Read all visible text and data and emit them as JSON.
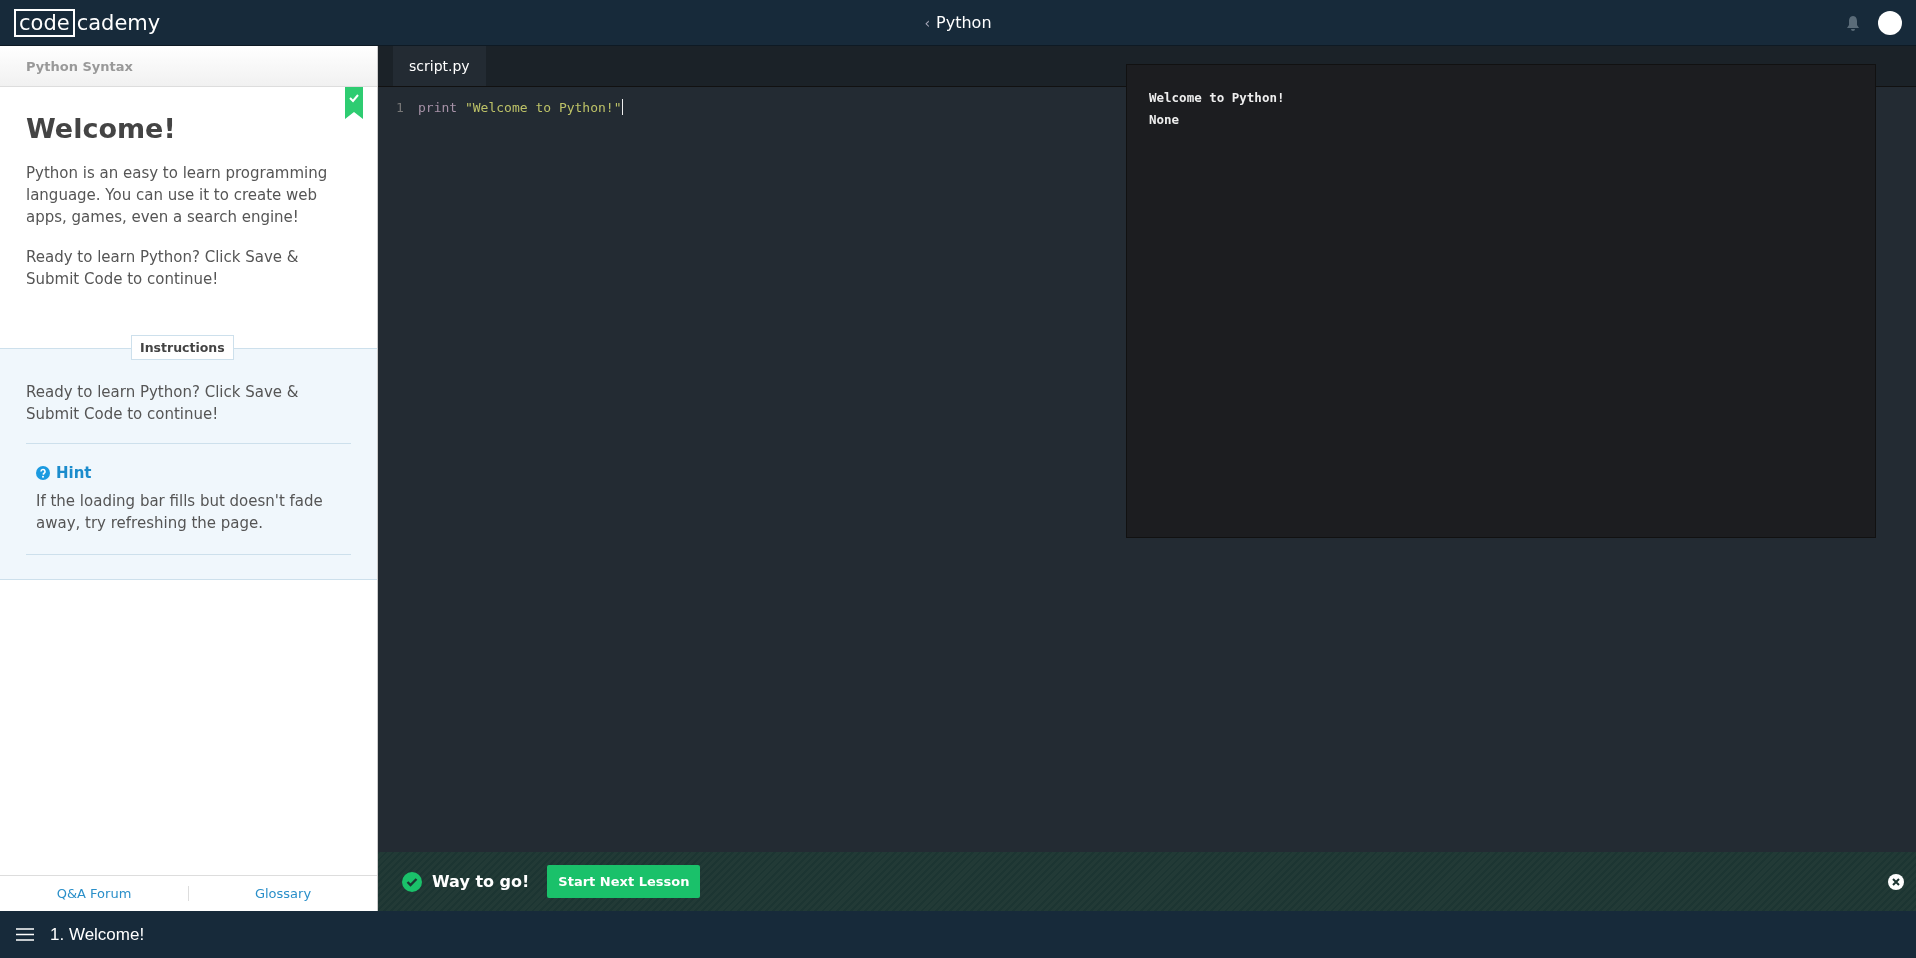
{
  "header": {
    "logo_boxed": "code",
    "logo_rest": "cademy",
    "course": "Python",
    "back_icon": "‹"
  },
  "sidebar": {
    "section": "Python Syntax",
    "completed": true,
    "title": "Welcome!",
    "paragraphs": [
      "Python is an easy to learn programming language. You can use it to create web apps, games, even a search engine!",
      "Ready to learn Python? Click Save & Submit Code to continue!"
    ],
    "instructions_label": "Instructions",
    "instructions": "Ready to learn Python? Click Save & Submit Code to continue!",
    "hint": {
      "label": "Hint",
      "text": "If the loading bar fills but doesn't fade away, try refreshing the page."
    },
    "footer_links": [
      "Q&A Forum",
      "Glossary"
    ]
  },
  "editor": {
    "tabs": [
      {
        "label": "script.py",
        "selected": true
      }
    ],
    "lines": [
      {
        "number": "1",
        "tokens": [
          {
            "kind": "keyword",
            "text": "print"
          },
          {
            "kind": "string",
            "text": "\"Welcome to Python!\""
          }
        ]
      }
    ]
  },
  "output": {
    "lines": [
      "Welcome to Python!",
      "None"
    ]
  },
  "feedback": {
    "message": "Way to go!",
    "button": "Start Next Lesson"
  },
  "status_bar": {
    "lesson": "1. Welcome!"
  }
}
